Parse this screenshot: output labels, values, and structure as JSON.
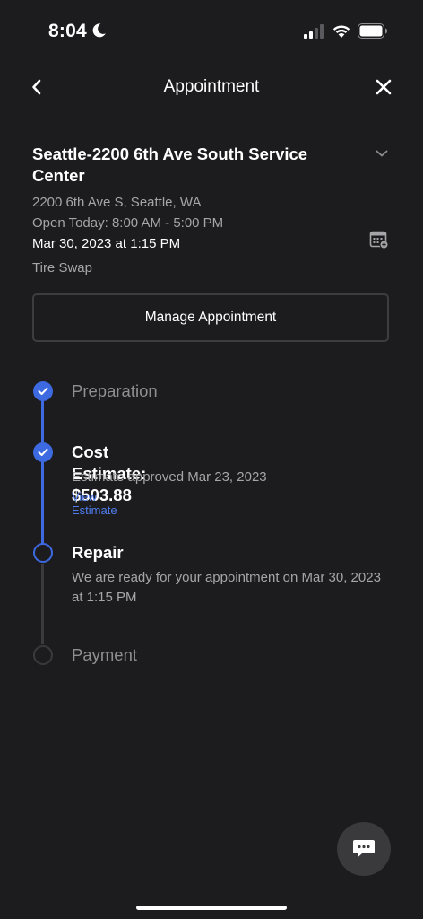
{
  "status_bar": {
    "time": "8:04"
  },
  "header": {
    "title": "Appointment"
  },
  "service_center": {
    "name": "Seattle-2200 6th Ave South Service Center",
    "address": "2200 6th Ave S, Seattle, WA",
    "hours": "Open Today: 8:00 AM - 5:00 PM",
    "appointment_datetime": "Mar 30, 2023 at 1:15 PM",
    "service_type": "Tire Swap"
  },
  "manage_button": {
    "label": "Manage Appointment"
  },
  "steps": [
    {
      "title": "Preparation",
      "status": "done"
    },
    {
      "title": "Cost Estimate: $503.88",
      "status": "done",
      "description": "Estimate approved Mar 23, 2023",
      "link": "View Estimate"
    },
    {
      "title": "Repair",
      "status": "current",
      "description": "We are ready for your appointment on Mar 30, 2023 at 1:15 PM"
    },
    {
      "title": "Payment",
      "status": "pending"
    }
  ],
  "colors": {
    "background": "#1c1c1e",
    "accent": "#3e6ae1",
    "link": "#4f7df0",
    "muted_text": "#a5a5aa"
  }
}
